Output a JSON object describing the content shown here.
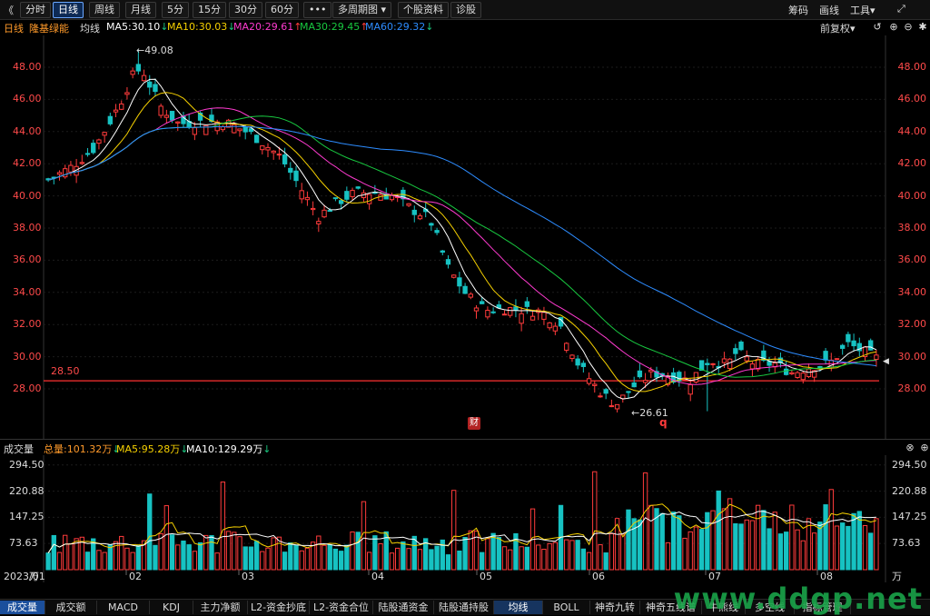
{
  "toolbar": {
    "back_icon": "chevron-left-icon",
    "periods": [
      "分时",
      "日线",
      "周线",
      "月线",
      "5分",
      "15分",
      "30分",
      "60分"
    ],
    "active_period": "日线",
    "more_label": "•••",
    "multi_label": "多周期图",
    "profile_label": "个股资料",
    "diag_label": "诊股",
    "right": [
      "筹码",
      "画线",
      "工具"
    ],
    "tool_caret": "▾",
    "expand_icon": "expand-icon"
  },
  "header": {
    "period_label": "日线",
    "stock_name": "隆基绿能",
    "avg_label": "均线",
    "ma5": "MA5:30.10",
    "ma5_arrow": "↓",
    "ma10": "MA10:30.03",
    "ma10_arrow": "↓",
    "ma20": "MA20:29.61",
    "ma20_arrow": "↑",
    "ma30": "MA30:29.45",
    "ma30_arrow": "↑",
    "ma60": "MA60:29.32",
    "ma60_arrow": "↓",
    "adjust_label": "前复权",
    "adjust_caret": "▾"
  },
  "colors": {
    "up": "#ff3b3b",
    "down": "#17c2c2",
    "ma5": "#ffffff",
    "ma10": "#f5d000",
    "ma20": "#ff3bd0",
    "ma30": "#18c940",
    "ma60": "#2d8cff",
    "support": "#ff3030"
  },
  "price_axis": {
    "ticks": [
      "48.00",
      "46.00",
      "44.00",
      "42.00",
      "40.00",
      "38.00",
      "36.00",
      "34.00",
      "32.00",
      "30.00",
      "28.00"
    ],
    "support_label": "28.50",
    "high_label": "49.08",
    "low_label": "26.61",
    "fin_badge": "财",
    "q_badge": "q"
  },
  "volume_header": {
    "title": "成交量",
    "total": "总量:101.32万",
    "total_arrow": "↓",
    "ma5": "MA5:95.28万",
    "ma5_arrow": "↓",
    "ma10": "MA10:129.29万",
    "ma10_arrow": "↓"
  },
  "volume_axis": {
    "ticks": [
      "294.50",
      "220.88",
      "147.25",
      "73.63"
    ],
    "unit": "万"
  },
  "x_axis": {
    "months": [
      "2023/01",
      "02",
      "03",
      "04",
      "05",
      "06",
      "07",
      "08"
    ]
  },
  "bottom_tabs": [
    "成交量",
    "成交额",
    "MACD",
    "KDJ",
    "主力净额",
    "L2-资金抄底",
    "L2-资金合位",
    "陆股通资金",
    "陆股通持股",
    "均线",
    "BOLL",
    "神奇九转",
    "神奇五线谱",
    "牛熊线",
    "多空线",
    "指标管理"
  ],
  "watermark": "www.ddgp.net",
  "chart_data": {
    "type": "candlestick",
    "title": "隆基绿能 日线",
    "ylim": [
      25.8,
      49.5
    ],
    "support": 28.5,
    "annotations": [
      {
        "label": "49.08",
        "value": 49.08
      },
      {
        "label": "26.61",
        "value": 26.61
      }
    ],
    "vol_ylim": [
      0,
      330
    ],
    "days": 148
  }
}
